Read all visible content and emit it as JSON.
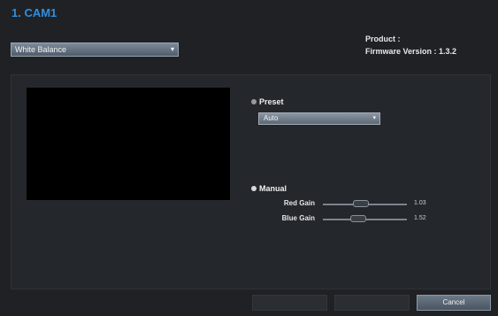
{
  "window": {
    "title": "1. CAM1"
  },
  "mode_select": {
    "value": "White Balance"
  },
  "device_info": {
    "product_label": "Product :",
    "firmware_label": "Firmware Version : 1.3.2"
  },
  "preset": {
    "label": "Preset",
    "selected": "Auto"
  },
  "manual": {
    "label": "Manual",
    "red_gain": {
      "label": "Red Gain",
      "value": "1.03",
      "level": 0.45
    },
    "blue_gain": {
      "label": "Blue Gain",
      "value": "1.52",
      "level": 0.42
    }
  },
  "buttons": {
    "btn1": "",
    "btn2": "",
    "cancel": "Cancel"
  }
}
